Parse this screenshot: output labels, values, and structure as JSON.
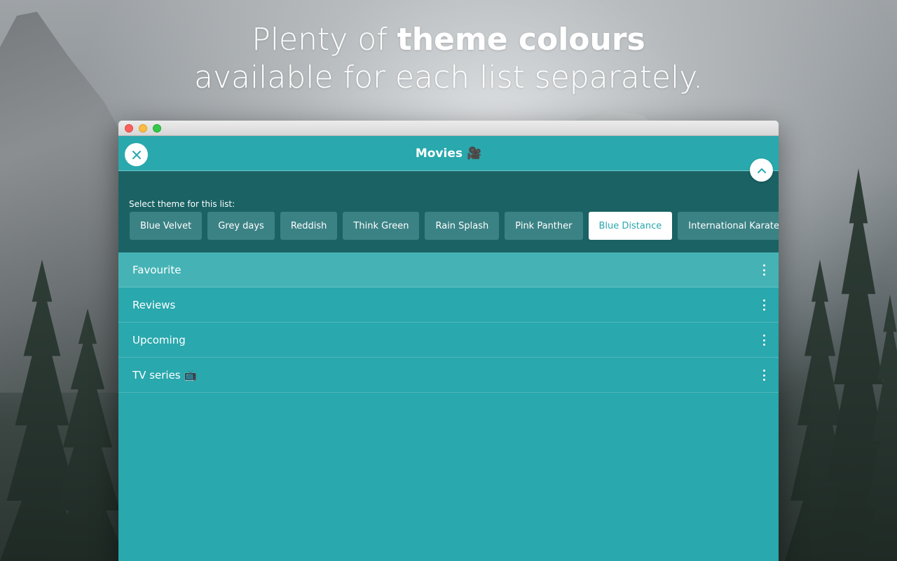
{
  "headline": {
    "line1_prefix": "Plenty of ",
    "line1_bold": "theme colours",
    "line2": "available for each list separately."
  },
  "window": {
    "title": "Movies",
    "title_emoji": "🎥",
    "close_icon": "close-icon",
    "collapse_icon": "chevron-up-icon"
  },
  "theme_panel": {
    "label": "Select theme for this list:",
    "themes": [
      {
        "label": "Blue Velvet",
        "active": false
      },
      {
        "label": "Grey days",
        "active": false
      },
      {
        "label": "Reddish",
        "active": false
      },
      {
        "label": "Think Green",
        "active": false
      },
      {
        "label": "Rain Splash",
        "active": false
      },
      {
        "label": "Pink Panther",
        "active": false
      },
      {
        "label": "Blue Distance",
        "active": true
      },
      {
        "label": "International Karate",
        "active": false
      }
    ]
  },
  "lists": [
    {
      "label": "Favourite",
      "emoji": ""
    },
    {
      "label": "Reviews",
      "emoji": ""
    },
    {
      "label": "Upcoming",
      "emoji": ""
    },
    {
      "label": "TV series",
      "emoji": "📺"
    }
  ],
  "colors": {
    "accent": "#29a8ad",
    "panel": "#1a6264",
    "theme_button": "#3b8285",
    "highlight_row": "#45b3b6"
  }
}
